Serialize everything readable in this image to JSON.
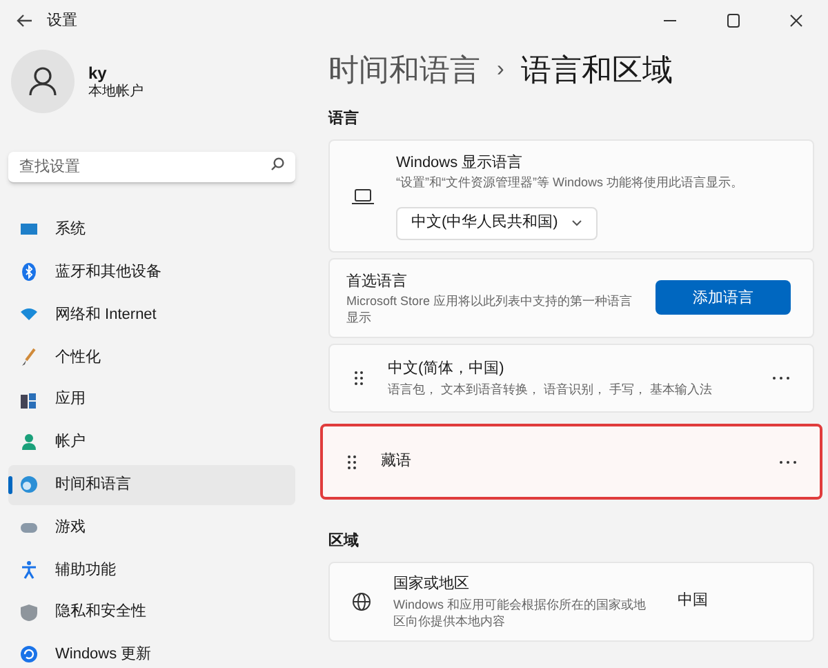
{
  "window": {
    "title": "设置"
  },
  "user": {
    "name": "ky",
    "account": "本地帐户"
  },
  "search": {
    "placeholder": "查找设置"
  },
  "nav": [
    {
      "label": "系统",
      "selected": false
    },
    {
      "label": "蓝牙和其他设备",
      "selected": false
    },
    {
      "label": "网络和 Internet",
      "selected": false
    },
    {
      "label": "个性化",
      "selected": false
    },
    {
      "label": "应用",
      "selected": false
    },
    {
      "label": "帐户",
      "selected": false
    },
    {
      "label": "时间和语言",
      "selected": true
    },
    {
      "label": "游戏",
      "selected": false
    },
    {
      "label": "辅助功能",
      "selected": false
    },
    {
      "label": "隐私和安全性",
      "selected": false
    },
    {
      "label": "Windows 更新",
      "selected": false
    }
  ],
  "breadcrumb": {
    "parent": "时间和语言",
    "separator": "›",
    "current": "语言和区域"
  },
  "language_section": {
    "heading": "语言",
    "display_language": {
      "title": "Windows 显示语言",
      "description": "“设置”和“文件资源管理器”等 Windows 功能将使用此语言显示。",
      "value": "中文(中华人民共和国)"
    },
    "preferred": {
      "title": "首选语言",
      "description": "Microsoft Store 应用将以此列表中支持的第一种语言显示",
      "button": "添加语言"
    },
    "languages": [
      {
        "name": "中文(简体，中国)",
        "features": "语言包， 文本到语音转换， 语音识别， 手写， 基本输入法",
        "highlighted": false
      },
      {
        "name": "藏语",
        "highlighted": true
      }
    ]
  },
  "region_section": {
    "heading": "区域",
    "country": {
      "title": "国家或地区",
      "description": "Windows 和应用可能会根据你所在的国家或地区向你提供本地内容",
      "value": "中国"
    }
  }
}
